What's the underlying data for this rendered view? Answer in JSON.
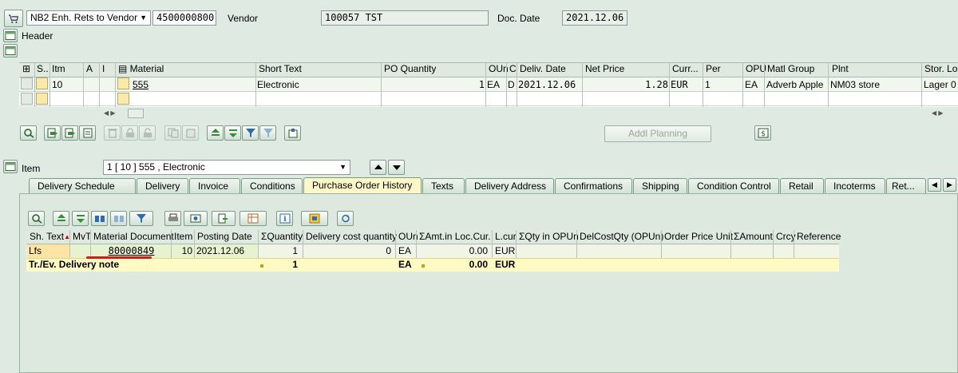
{
  "header": {
    "order_type": "NB2 Enh. Rets to Vendor",
    "po_number": "4500000800",
    "vendor_label": "Vendor",
    "vendor_value": "100057 TST",
    "doc_date_label": "Doc. Date",
    "doc_date_value": "2021.12.06",
    "header_label": "Header"
  },
  "items_table": {
    "columns": [
      "S..",
      "Itm",
      "A",
      "I",
      "Material",
      "Short Text",
      "PO Quantity",
      "OUn",
      "C",
      "Deliv. Date",
      "Net Price",
      "Curr...",
      "Per",
      "OPU",
      "Matl Group",
      "Plnt",
      "Stor. Lo"
    ],
    "rows": [
      {
        "itm": "10",
        "material": "555",
        "short_text": "Electronic",
        "po_quantity": "1",
        "oun": "EA",
        "c": "D",
        "deliv_date": "2021.12.06",
        "net_price": "1.28",
        "curr": "EUR",
        "per": "1",
        "opu": "EA",
        "matl_group": "Adverb Apple",
        "plnt": "NM03 store",
        "stor_loc": "Lager 0"
      }
    ]
  },
  "addl_planning_label": "Addl Planning",
  "item_section": {
    "label": "Item",
    "selected": "1 [ 10 ] 555 , Electronic"
  },
  "tabs": [
    "Delivery Schedule",
    "Delivery",
    "Invoice",
    "Conditions",
    "Purchase Order History",
    "Texts",
    "Delivery Address",
    "Confirmations",
    "Shipping",
    "Condition Control",
    "Retail",
    "Incoterms",
    "Ret..."
  ],
  "active_tab": "Purchase Order History",
  "history_table": {
    "columns": [
      "Sh. Text",
      "MvT",
      "Material Document",
      "Item",
      "Posting Date",
      "ΣQuantity",
      "Delivery cost quantity",
      "OUn",
      "ΣAmt.in Loc.Cur.",
      "L.cur",
      "ΣQty in OPUn",
      "DelCostQty (OPUn)",
      "Order Price Unit",
      "ΣAmount",
      "Crcy",
      "Reference"
    ],
    "row": {
      "sh_text": "Lfs",
      "mvt": "",
      "material_document": "80000849",
      "item": "10",
      "posting_date": "2021.12.06",
      "quantity": "1",
      "delivery_cost_quantity": "0",
      "oun": "EA",
      "amt_loc_cur": "0.00",
      "l_cur": "EUR"
    },
    "total": {
      "label": "Tr./Ev. Delivery note",
      "quantity": "1",
      "oun": "EA",
      "amt_loc_cur": "0.00",
      "l_cur": "EUR"
    }
  },
  "icons": [
    "cart-icon",
    "header-toggle-icon",
    "detail-icon",
    "search-icon",
    "copy-icon",
    "delete-icon",
    "lock-icon",
    "sort-asc-icon",
    "sort-desc-icon",
    "filter-icon",
    "print-icon",
    "export-icon",
    "layout-icon",
    "info-icon",
    "refresh-icon",
    "arrow-up-icon",
    "arrow-down-icon"
  ],
  "colors": {
    "background": "#dfebe2",
    "active_tab": "#fef7c8",
    "total_row": "#fff9c4",
    "underline": "#d11b1b"
  }
}
